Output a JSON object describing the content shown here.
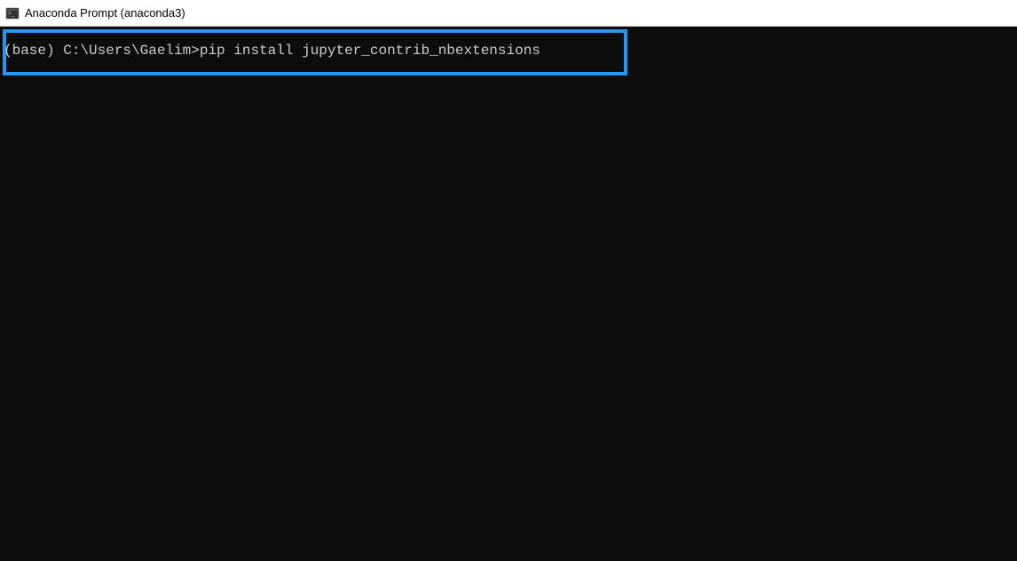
{
  "window": {
    "title": "Anaconda Prompt (anaconda3)"
  },
  "terminal": {
    "prompt": "(base) C:\\Users\\Gaelim>",
    "command": "pip install jupyter_contrib_nbextensions"
  }
}
